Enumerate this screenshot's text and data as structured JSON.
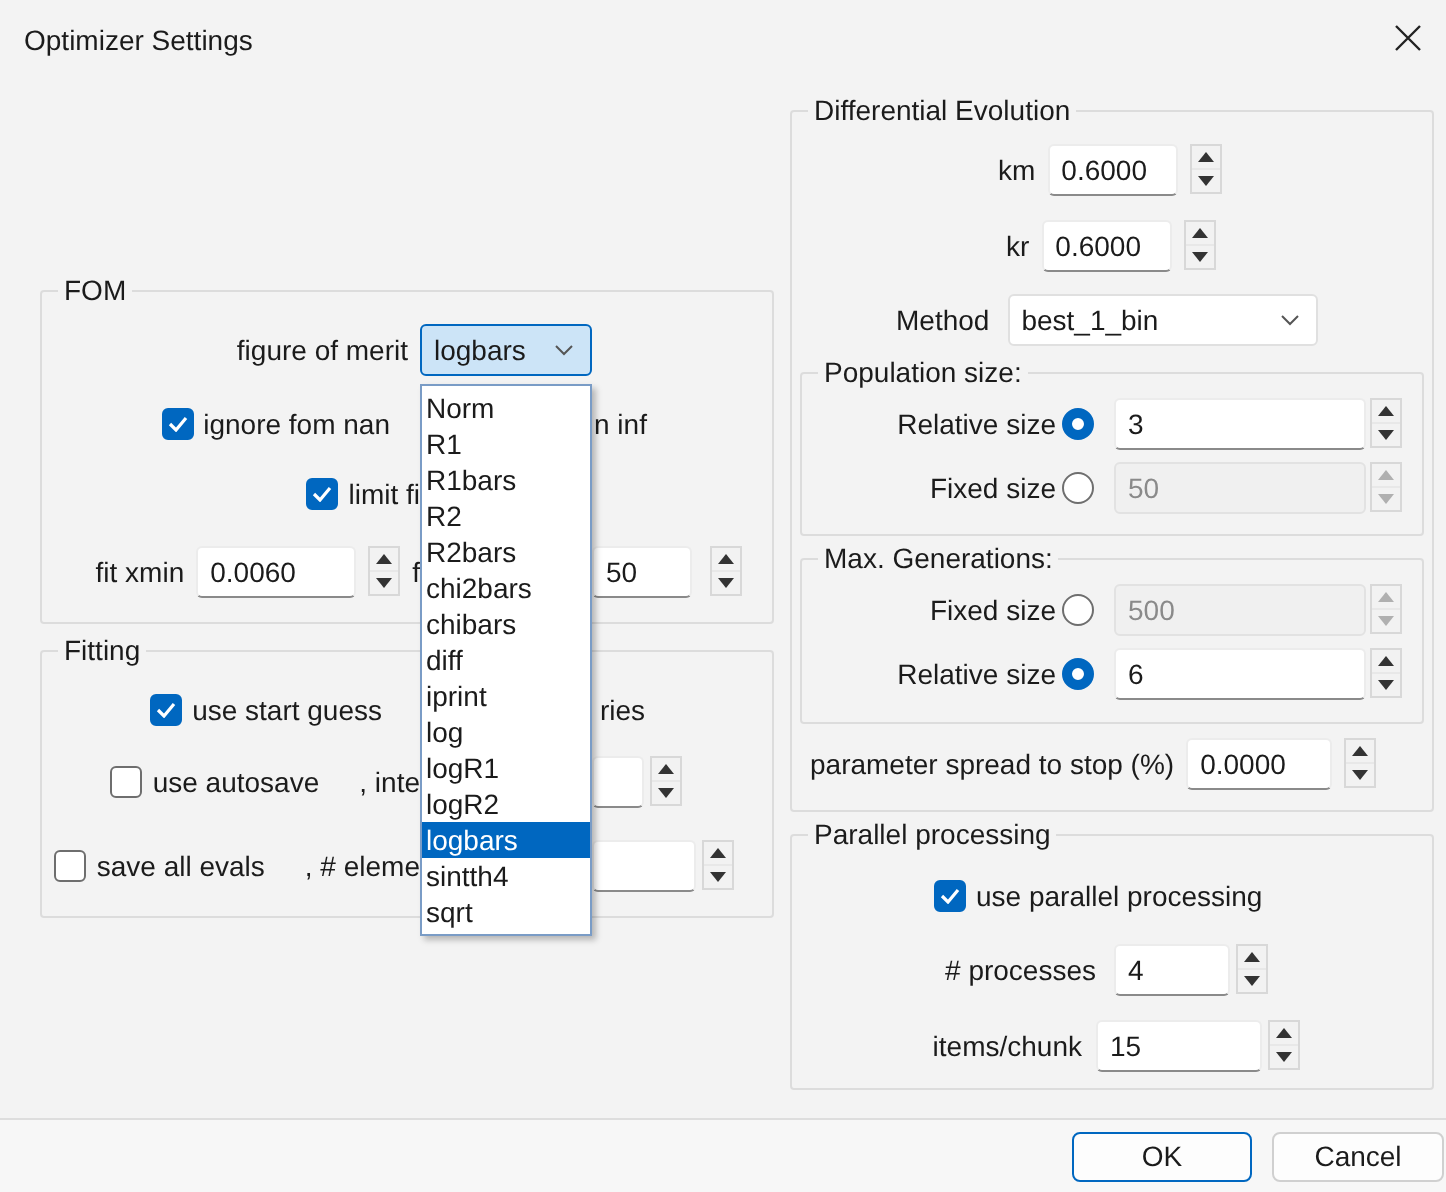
{
  "window": {
    "title": "Optimizer Settings"
  },
  "fom": {
    "title": "FOM",
    "figure_of_merit": {
      "label": "figure of merit",
      "value": "logbars",
      "expanded": true,
      "options": [
        {
          "label": "Norm",
          "selected": false
        },
        {
          "label": "R1",
          "selected": false
        },
        {
          "label": "R1bars",
          "selected": false
        },
        {
          "label": "R2",
          "selected": false
        },
        {
          "label": "R2bars",
          "selected": false
        },
        {
          "label": "chi2bars",
          "selected": false
        },
        {
          "label": "chibars",
          "selected": false
        },
        {
          "label": "diff",
          "selected": false
        },
        {
          "label": "iprint",
          "selected": false
        },
        {
          "label": "log",
          "selected": false
        },
        {
          "label": "logR1",
          "selected": false
        },
        {
          "label": "logR2",
          "selected": false
        },
        {
          "label": "logbars",
          "selected": true
        },
        {
          "label": "sintth4",
          "selected": false
        },
        {
          "label": "sqrt",
          "selected": false
        }
      ]
    },
    "ignore_nan": {
      "label": "ignore fom nan",
      "checked": true
    },
    "ignore_inf": {
      "label_tail": "n inf"
    },
    "limit_fit": {
      "label": "limit fi",
      "checked": true
    },
    "fit_xmin": {
      "label": "fit xmin",
      "value": "0.0060"
    },
    "fit_xmax": {
      "label_head": "f",
      "value_tail": "50"
    }
  },
  "fitting": {
    "title": "Fitting",
    "use_start_guess": {
      "label": "use start guess",
      "checked": true
    },
    "use_boundaries": {
      "label_tail": "ries"
    },
    "autosave": {
      "label": "use autosave",
      "checked": false,
      "interval_label_head": ", inte"
    },
    "save_all_evals": {
      "label": "save all evals",
      "checked": false,
      "elements_label_head": ", # eleme"
    }
  },
  "differential_evolution": {
    "title": "Differential Evolution",
    "km": {
      "label": "km",
      "value": "0.6000"
    },
    "kr": {
      "label": "kr",
      "value": "0.6000"
    },
    "method": {
      "label": "Method",
      "value": "best_1_bin"
    },
    "population_size": {
      "title": "Population size:",
      "options": [
        {
          "label": "Relative size",
          "selected": true,
          "value": "3"
        },
        {
          "label": "Fixed size",
          "selected": false,
          "value": "50"
        }
      ]
    },
    "max_generations": {
      "title": "Max. Generations:",
      "options": [
        {
          "label": "Fixed size",
          "selected": false,
          "value": "500"
        },
        {
          "label": "Relative size",
          "selected": true,
          "value": "6"
        }
      ]
    },
    "parameter_spread": {
      "label": "parameter spread to stop (%)",
      "value": "0.0000"
    }
  },
  "parallel_processing": {
    "title": "Parallel processing",
    "use_parallel": {
      "label": "use parallel processing",
      "checked": true
    },
    "processes": {
      "label": "# processes",
      "value": "4"
    },
    "items_per_chunk": {
      "label": "items/chunk",
      "value": "15"
    }
  },
  "buttons": [
    {
      "label": "OK",
      "default": true
    },
    {
      "label": "Cancel",
      "default": false
    }
  ]
}
